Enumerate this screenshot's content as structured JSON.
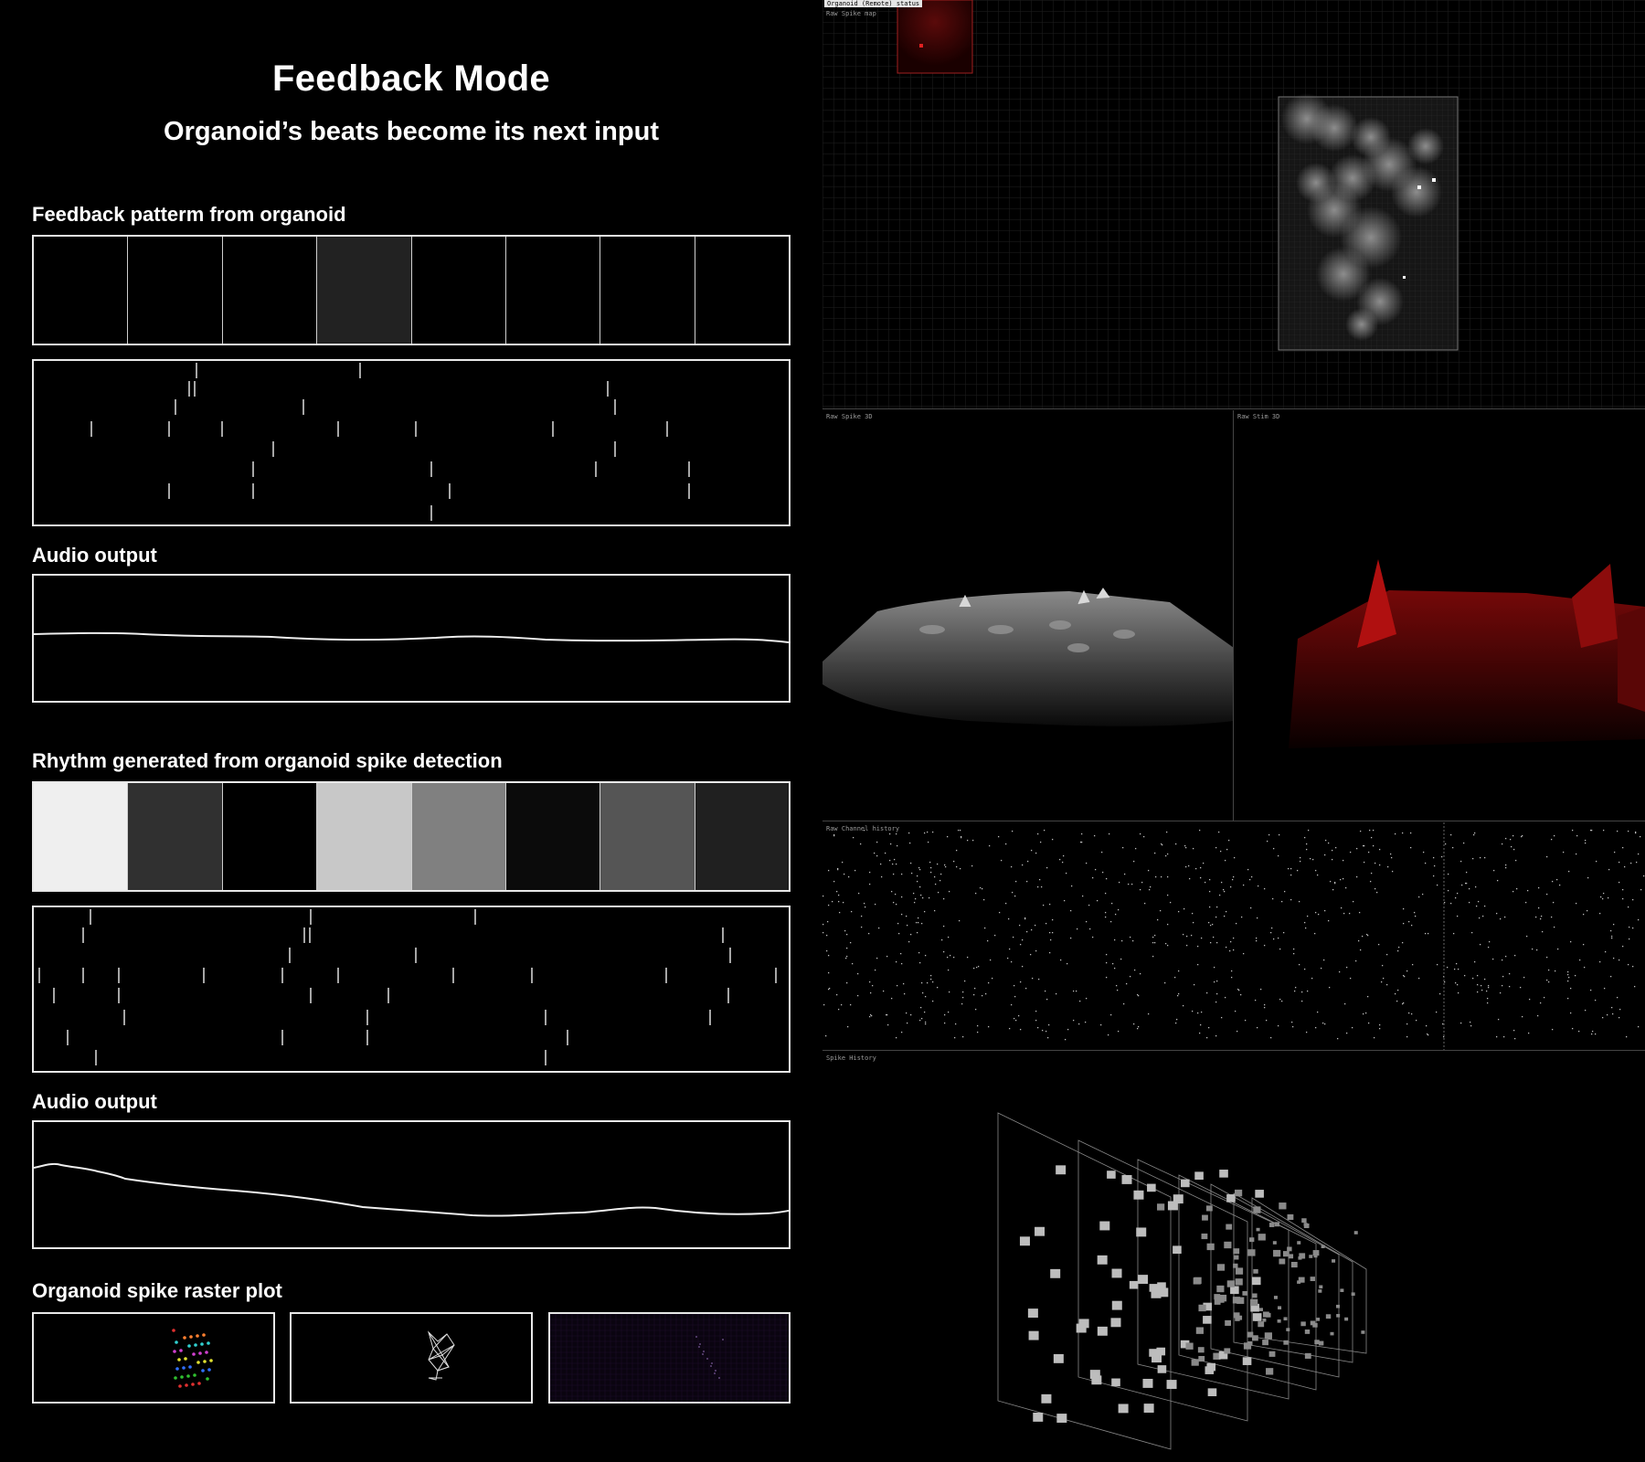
{
  "header": {
    "title": "Feedback Mode",
    "subtitle": "Organoid’s beats become its next input"
  },
  "feedback_section": {
    "label": "Feedback patterm from organoid",
    "pattern_cells": [
      "#000000",
      "#000000",
      "#000000",
      "#222222",
      "#000000",
      "#000000",
      "#000000",
      "#000000"
    ],
    "audio_label": "Audio output"
  },
  "rhythm_section": {
    "label": "Rhythm generated from organoid spike detection",
    "pattern_cells": [
      "#efefef",
      "#303030",
      "#000000",
      "#c8c8c8",
      "#808080",
      "#0b0b0b",
      "#555555",
      "#202020"
    ],
    "audio_label": "Audio output"
  },
  "raster_section": {
    "label": "Organoid spike raster plot"
  },
  "right_panels": {
    "status_label": "Organoid (Remote) status",
    "spike_map_label": "Raw Spike map",
    "spike_3d_label": "Raw Spike 3D",
    "stim_3d_label": "Raw Stim 3D",
    "channel_history_label": "Raw Channel history",
    "spike_history_label": "Spike History"
  },
  "colors": {
    "background": "#000000",
    "text": "#ffffff",
    "frame": "#e8e8e8",
    "stim_red": "#c01010"
  }
}
